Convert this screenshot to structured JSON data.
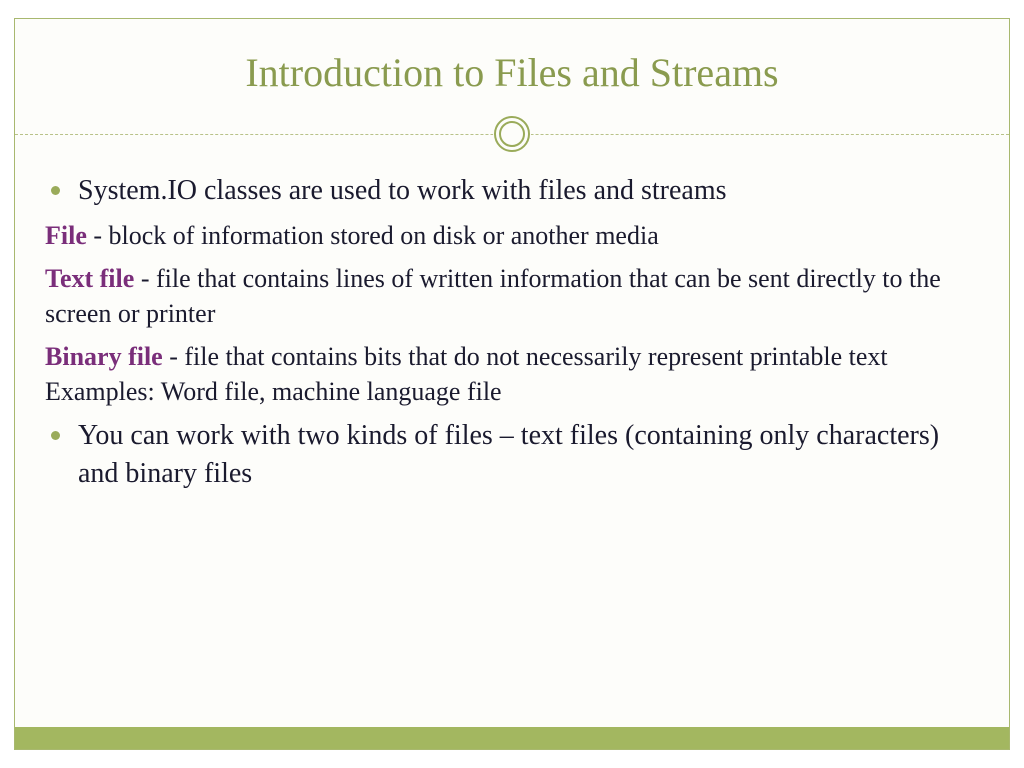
{
  "title": "Introduction to Files and Streams",
  "bullets": {
    "b1": "System.IO classes are used to work with files and streams",
    "b2": "You can work with two kinds of files – text files (containing only characters) and binary files"
  },
  "defs": {
    "file": {
      "term": "File",
      "body": " - block of information stored on disk or another media"
    },
    "text": {
      "term": "Text file",
      "body": " - file that contains lines of written information that can be sent directly to the screen or printer"
    },
    "binary": {
      "term": "Binary file",
      "body": " - file that contains bits that do not necessarily represent printable text Examples: Word file, machine language file"
    }
  }
}
